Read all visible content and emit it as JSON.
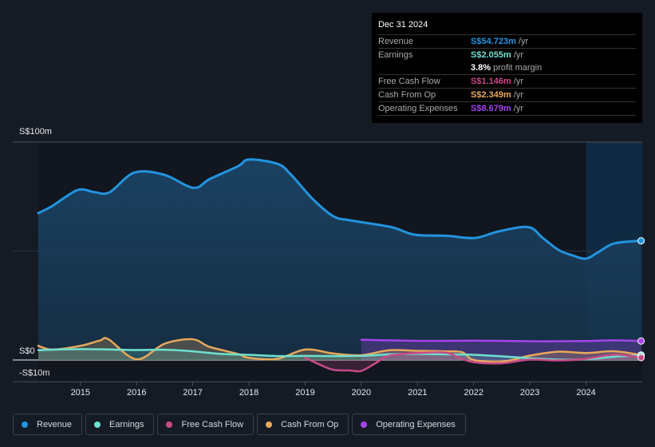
{
  "tooltip": {
    "date": "Dec 31 2024",
    "rows": [
      {
        "label": "Revenue",
        "value": "S$54.723m",
        "unit": "/yr",
        "color": "#2394df"
      },
      {
        "label": "Earnings",
        "value": "S$2.055m",
        "unit": "/yr",
        "color": "#6ee0cf"
      },
      {
        "label": "",
        "value": "3.8%",
        "unit": "profit margin",
        "color": "#ffffff"
      },
      {
        "label": "Free Cash Flow",
        "value": "S$1.146m",
        "unit": "/yr",
        "color": "#c84a88"
      },
      {
        "label": "Cash From Op",
        "value": "S$2.349m",
        "unit": "/yr",
        "color": "#e8a85a"
      },
      {
        "label": "Operating Expenses",
        "value": "S$8.679m",
        "unit": "/yr",
        "color": "#a445ea"
      }
    ]
  },
  "legend": [
    {
      "label": "Revenue",
      "color": "#2394df"
    },
    {
      "label": "Earnings",
      "color": "#6ee0cf"
    },
    {
      "label": "Free Cash Flow",
      "color": "#c84a88"
    },
    {
      "label": "Cash From Op",
      "color": "#e8a85a"
    },
    {
      "label": "Operating Expenses",
      "color": "#a445ea"
    }
  ],
  "chart_data": {
    "type": "area",
    "title": "",
    "xlabel": "",
    "ylabel": "",
    "ylim": [
      -10,
      100
    ],
    "xlim": [
      2014.25,
      2025.0
    ],
    "y_tick_labels": [
      {
        "value": 100,
        "label": "S$100m"
      },
      {
        "value": 0,
        "label": "S$0"
      },
      {
        "value": -10,
        "label": "-S$10m"
      }
    ],
    "x_ticks": [
      2015,
      2016,
      2017,
      2018,
      2019,
      2020,
      2021,
      2022,
      2023,
      2024
    ],
    "highlight_range": [
      2024.0,
      2025.0
    ],
    "series": [
      {
        "name": "Revenue",
        "color": "#2394df",
        "x": [
          2014.25,
          2014.5,
          2014.95,
          2015.25,
          2015.52,
          2015.96,
          2016.49,
          2017.01,
          2017.3,
          2017.81,
          2018.0,
          2018.51,
          2018.75,
          2019.13,
          2019.5,
          2019.82,
          2020.53,
          2020.95,
          2021.52,
          2022.02,
          2022.44,
          2022.97,
          2023.23,
          2023.51,
          2023.76,
          2024.0,
          2024.22,
          2024.5,
          2024.98
        ],
        "values": [
          67.4,
          70.7,
          78,
          77,
          77,
          86,
          85,
          79,
          83,
          89,
          92,
          90,
          85,
          74,
          66,
          64,
          61,
          57.5,
          57,
          56,
          59,
          61,
          56,
          50.5,
          48,
          46.5,
          49.5,
          53.5,
          54.7
        ]
      },
      {
        "name": "Earnings",
        "color": "#6ee0cf",
        "x": [
          2014.25,
          2015.0,
          2016.0,
          2016.5,
          2017.0,
          2017.5,
          2018.0,
          2018.5,
          2019.0,
          2019.5,
          2020.0,
          2020.5,
          2021.0,
          2021.5,
          2022.0,
          2022.5,
          2023.0,
          2023.5,
          2024.0,
          2024.5,
          2024.98
        ],
        "values": [
          4.5,
          5.0,
          4.6,
          4.7,
          4.0,
          2.8,
          2.4,
          1.8,
          1.9,
          1.8,
          1.9,
          2.6,
          2.8,
          2.6,
          2.4,
          1.7,
          0.8,
          0.2,
          0.3,
          1.5,
          2.1
        ]
      },
      {
        "name": "Free Cash Flow",
        "color": "#c84a88",
        "x": [
          2019.0,
          2019.25,
          2019.5,
          2019.8,
          2020.0,
          2020.25,
          2020.5,
          2021.0,
          2021.5,
          2021.75,
          2022.0,
          2022.5,
          2023.0,
          2023.5,
          2024.0,
          2024.5,
          2024.98
        ],
        "values": [
          1.0,
          -2.0,
          -4.5,
          -4.8,
          -5.0,
          -1.5,
          2.0,
          3.2,
          3.4,
          1.0,
          -1.0,
          -1.5,
          0.2,
          -0.2,
          0.5,
          2.5,
          1.1
        ]
      },
      {
        "name": "Cash From Op",
        "color": "#e8a85a",
        "x": [
          2014.25,
          2014.5,
          2015.0,
          2015.35,
          2015.5,
          2016.0,
          2016.5,
          2017.0,
          2017.3,
          2017.8,
          2018.0,
          2018.5,
          2019.0,
          2019.5,
          2020.0,
          2020.5,
          2021.0,
          2021.5,
          2021.8,
          2022.0,
          2022.5,
          2023.0,
          2023.5,
          2024.0,
          2024.5,
          2024.98
        ],
        "values": [
          6.5,
          4.8,
          6.5,
          9.0,
          9.5,
          0.3,
          7.5,
          9.5,
          6.0,
          2.8,
          1.0,
          0.5,
          4.8,
          3.0,
          2.2,
          4.5,
          4.2,
          4.0,
          3.5,
          0.0,
          -0.8,
          2.0,
          3.8,
          3.2,
          4.0,
          2.3
        ]
      },
      {
        "name": "Operating Expenses",
        "color": "#a445ea",
        "x": [
          2020.0,
          2020.5,
          2021.0,
          2021.5,
          2022.0,
          2022.5,
          2023.0,
          2023.5,
          2024.0,
          2024.5,
          2024.98
        ],
        "values": [
          9.3,
          9.0,
          8.8,
          8.8,
          8.9,
          8.8,
          8.6,
          8.6,
          8.7,
          9.0,
          8.7
        ]
      }
    ]
  }
}
